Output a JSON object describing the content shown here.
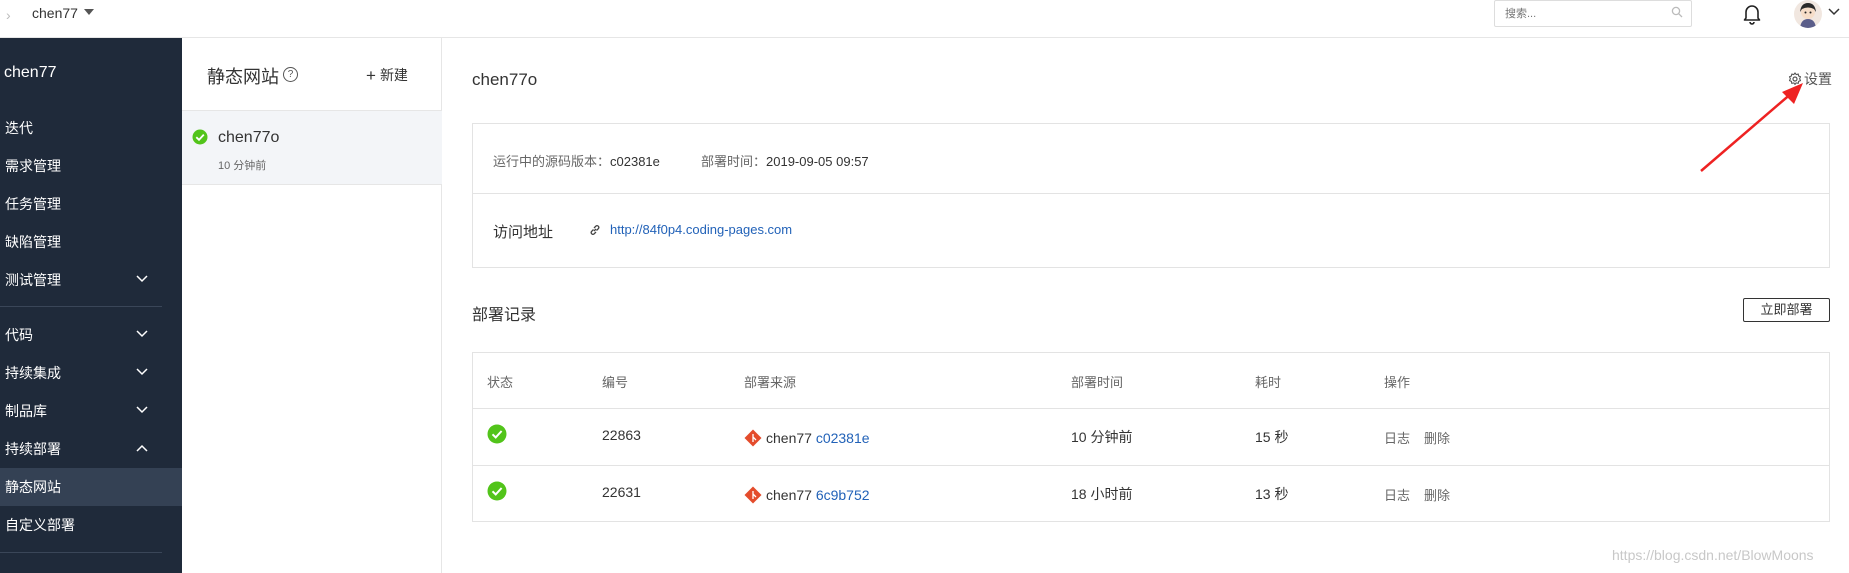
{
  "topbar": {
    "project_name": "chen77",
    "search_placeholder": "搜索..."
  },
  "sidebar": {
    "title": "chen77",
    "items": [
      {
        "label": "迭代"
      },
      {
        "label": "需求管理"
      },
      {
        "label": "任务管理"
      },
      {
        "label": "缺陷管理"
      },
      {
        "label": "测试管理",
        "expand": "down"
      },
      {
        "label": "代码",
        "expand": "down"
      },
      {
        "label": "持续集成",
        "expand": "down"
      },
      {
        "label": "制品库",
        "expand": "down"
      },
      {
        "label": "持续部署",
        "expand": "up"
      },
      {
        "label": "静态网站",
        "active": true
      },
      {
        "label": "自定义部署"
      }
    ]
  },
  "list_panel": {
    "title": "静态网站",
    "help": "?",
    "new_label": "新建",
    "sites": [
      {
        "name": "chen77o",
        "time": "10 分钟前",
        "status": "success"
      }
    ]
  },
  "main": {
    "title": "chen77o",
    "settings_label": "设置",
    "info": {
      "version_label": "运行中的源码版本：",
      "version": "c02381e",
      "deploy_time_label": "部署时间：",
      "deploy_time": "2019-09-05 09:57",
      "url_label": "访问地址",
      "url": "http://84f0p4.coding-pages.com"
    },
    "deploy": {
      "title": "部署记录",
      "deploy_now": "立即部署",
      "columns": [
        "状态",
        "编号",
        "部署来源",
        "部署时间",
        "耗时",
        "操作"
      ],
      "rows": [
        {
          "status": "success",
          "id": "22863",
          "source_user": "chen77",
          "commit": "c02381e",
          "time": "10 分钟前",
          "duration": "15 秒",
          "log": "日志",
          "delete": "删除"
        },
        {
          "status": "success",
          "id": "22631",
          "source_user": "chen77",
          "commit": "6c9b752",
          "time": "18 小时前",
          "duration": "13 秒",
          "log": "日志",
          "delete": "删除"
        }
      ]
    }
  },
  "watermark": "https://blog.csdn.net/BlowMoons",
  "colors": {
    "sidebar_bg": "#1f2a3a",
    "sidebar_active": "#344154",
    "link": "#2262b8",
    "success": "#52c41a",
    "git": "#e44c2c",
    "annotation_arrow": "#ee2222"
  }
}
